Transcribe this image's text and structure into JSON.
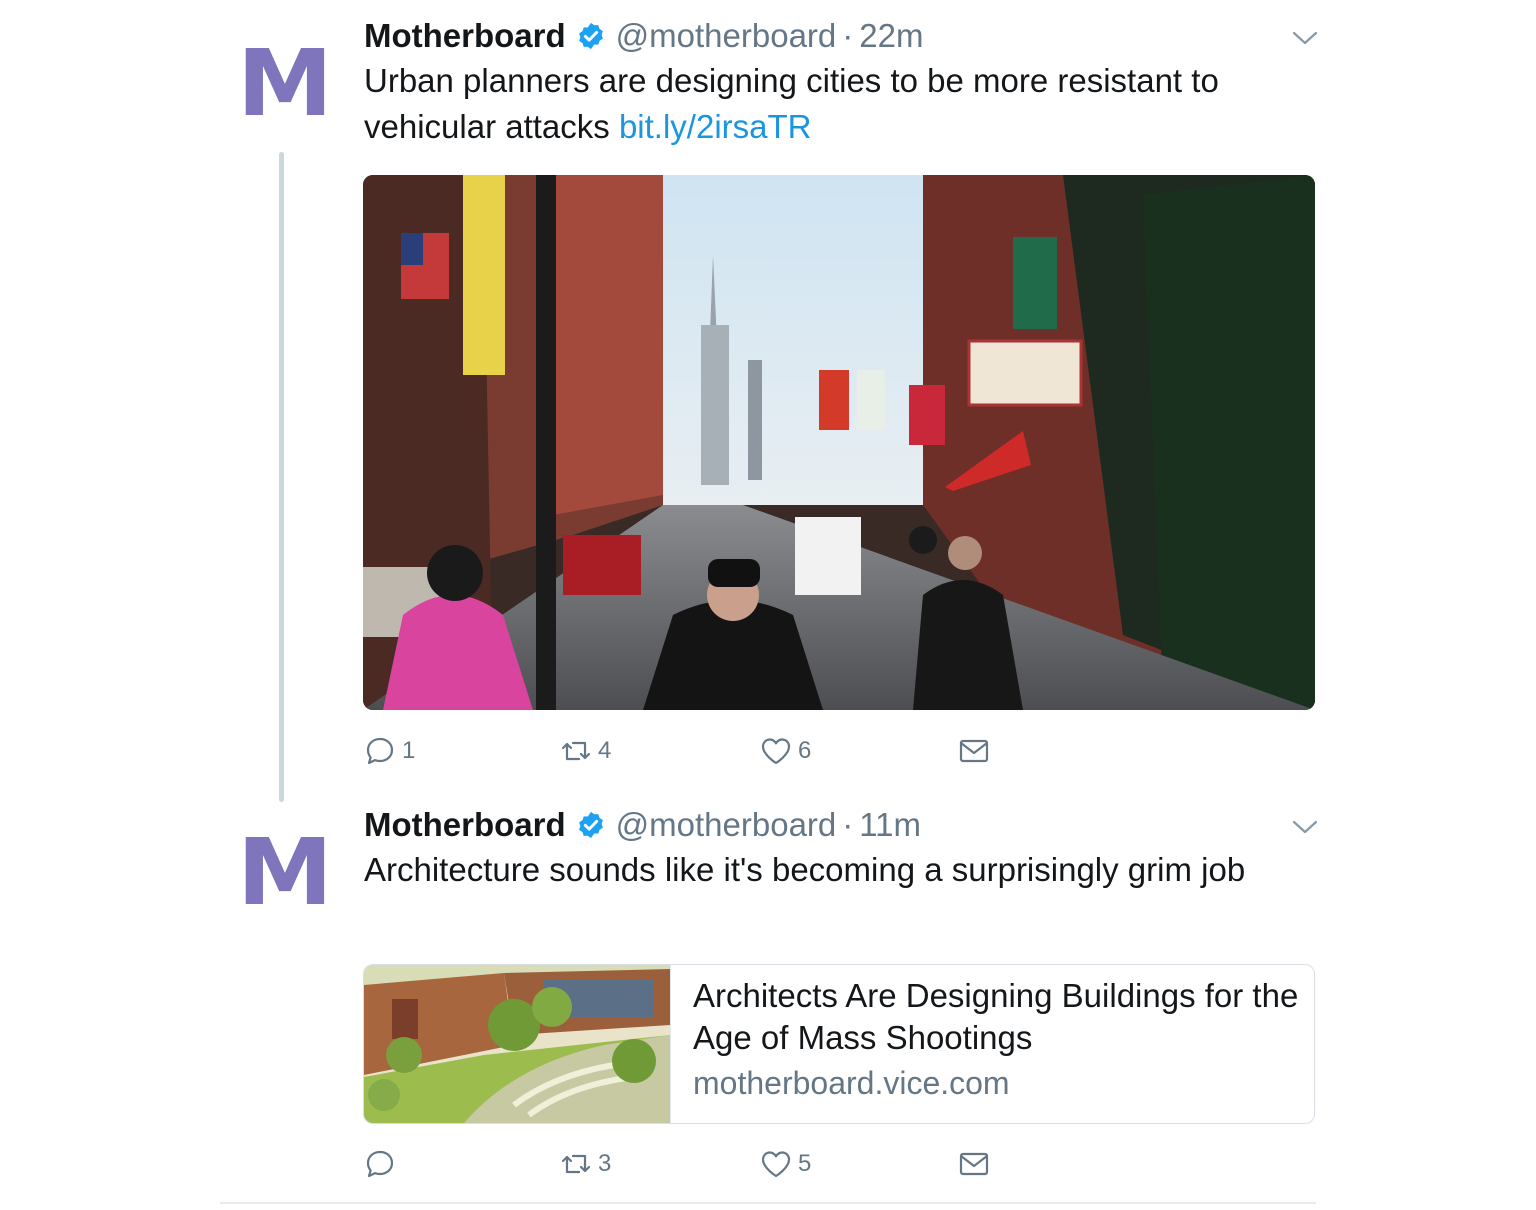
{
  "tweets": [
    {
      "avatar_letter": "M",
      "name": "Motherboard",
      "handle": "@motherboard",
      "separator": "·",
      "time": "22m",
      "text": "Urban planners are designing cities to be more resistant to vehicular attacks",
      "link": "bit.ly/2irsaTR",
      "actions": {
        "reply": "1",
        "retweet": "4",
        "like": "6"
      }
    },
    {
      "avatar_letter": "M",
      "name": "Motherboard",
      "handle": "@motherboard",
      "separator": "·",
      "time": "11m",
      "text": "Architecture sounds like it's becoming a surprisingly grim job",
      "card": {
        "title": "Architects Are Designing Buildings for the Age of Mass Shootings",
        "domain": "motherboard.vice.com"
      },
      "actions": {
        "reply": "",
        "retweet": "3",
        "like": "5"
      }
    }
  ],
  "icons": {
    "verified": "verified-badge-icon",
    "caret": "chevron-down-icon",
    "reply": "reply-icon",
    "retweet": "retweet-icon",
    "like": "heart-icon",
    "dm": "direct-message-icon"
  },
  "colors": {
    "avatar": "#7f75bd",
    "link": "#1b95e0",
    "verified": "#1da1f2",
    "muted": "#657786",
    "thread_line": "#ccd6dd"
  }
}
